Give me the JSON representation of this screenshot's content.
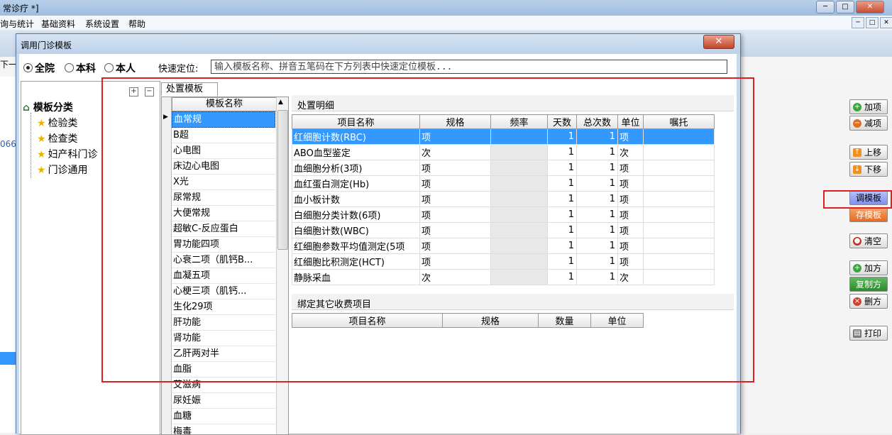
{
  "app": {
    "title": "常诊疗 *]",
    "menu": [
      "询与统计",
      "基础资料",
      "系统设置",
      "帮助"
    ],
    "left_fragments": [
      "下一",
      "066"
    ]
  },
  "window_controls": {
    "minimize": "─",
    "restore": "□",
    "close": "✕"
  },
  "right_toolbar": {
    "add_item": "加项",
    "remove_item": "减项",
    "move_up": "上移",
    "move_down": "下移",
    "load_template": "调模板",
    "save_template": "存模板",
    "clear": "清空",
    "add_prescription": "加方",
    "copy_prescription": "复制方",
    "delete_prescription": "删方",
    "print": "打印"
  },
  "dialog": {
    "title": "调用门诊模板",
    "close": "✕",
    "scope_options": [
      {
        "label": "全院",
        "selected": true
      },
      {
        "label": "本科",
        "selected": false
      },
      {
        "label": "本人",
        "selected": false
      }
    ],
    "quick_locate_label": "快速定位:",
    "quick_locate_placeholder": "输入模板名称、拼音五笔码在下方列表中快速定位模板...",
    "tree": {
      "expand": "+",
      "collapse": "−",
      "root": "模板分类",
      "items": [
        "检验类",
        "检查类",
        "妇产科门诊",
        "门诊通用"
      ]
    },
    "tab": "处置模板",
    "template_list": {
      "header": "模板名称",
      "rows": [
        "血常规",
        "B超",
        "心电图",
        "床边心电图",
        "X光",
        "尿常规",
        "大便常规",
        "超敏C-反应蛋白",
        "胃功能四项",
        "心衰二项（肌钙B...",
        "血凝五项",
        "心梗三项（肌钙...",
        "生化29项",
        "肝功能",
        "肾功能",
        "乙肝两对半",
        "血脂",
        "艾滋病",
        "尿妊娠",
        "血糖",
        "梅毒"
      ],
      "selected_index": 0
    },
    "detail": {
      "label": "处置明细",
      "columns": [
        "项目名称",
        "规格",
        "频率",
        "天数",
        "总次数",
        "单位",
        "嘱托"
      ],
      "rows": [
        {
          "name": "红细胞计数(RBC)",
          "spec": "项",
          "freq": "",
          "days": "1",
          "total": "1",
          "unit": "项",
          "note": ""
        },
        {
          "name": "ABO血型鉴定",
          "spec": "次",
          "freq": "",
          "days": "1",
          "total": "1",
          "unit": "次",
          "note": ""
        },
        {
          "name": "血细胞分析(3项)",
          "spec": "项",
          "freq": "",
          "days": "1",
          "total": "1",
          "unit": "项",
          "note": ""
        },
        {
          "name": "血红蛋白测定(Hb)",
          "spec": "项",
          "freq": "",
          "days": "1",
          "total": "1",
          "unit": "项",
          "note": ""
        },
        {
          "name": "血小板计数",
          "spec": "项",
          "freq": "",
          "days": "1",
          "total": "1",
          "unit": "项",
          "note": ""
        },
        {
          "name": "白细胞分类计数(6项)",
          "spec": "项",
          "freq": "",
          "days": "1",
          "total": "1",
          "unit": "项",
          "note": ""
        },
        {
          "name": "白细胞计数(WBC)",
          "spec": "项",
          "freq": "",
          "days": "1",
          "total": "1",
          "unit": "项",
          "note": ""
        },
        {
          "name": "红细胞参数平均值测定(5项",
          "spec": "项",
          "freq": "",
          "days": "1",
          "total": "1",
          "unit": "项",
          "note": ""
        },
        {
          "name": "红细胞比积测定(HCT)",
          "spec": "项",
          "freq": "",
          "days": "1",
          "total": "1",
          "unit": "项",
          "note": ""
        },
        {
          "name": "静脉采血",
          "spec": "次",
          "freq": "",
          "days": "1",
          "total": "1",
          "unit": "次",
          "note": ""
        }
      ],
      "selected_index": 0
    },
    "bind": {
      "label": "绑定其它收费项目",
      "columns": [
        "项目名称",
        "规格",
        "数量",
        "单位"
      ]
    }
  },
  "colors": {
    "selection": "#3399ff",
    "highlight_box": "#e02020"
  }
}
